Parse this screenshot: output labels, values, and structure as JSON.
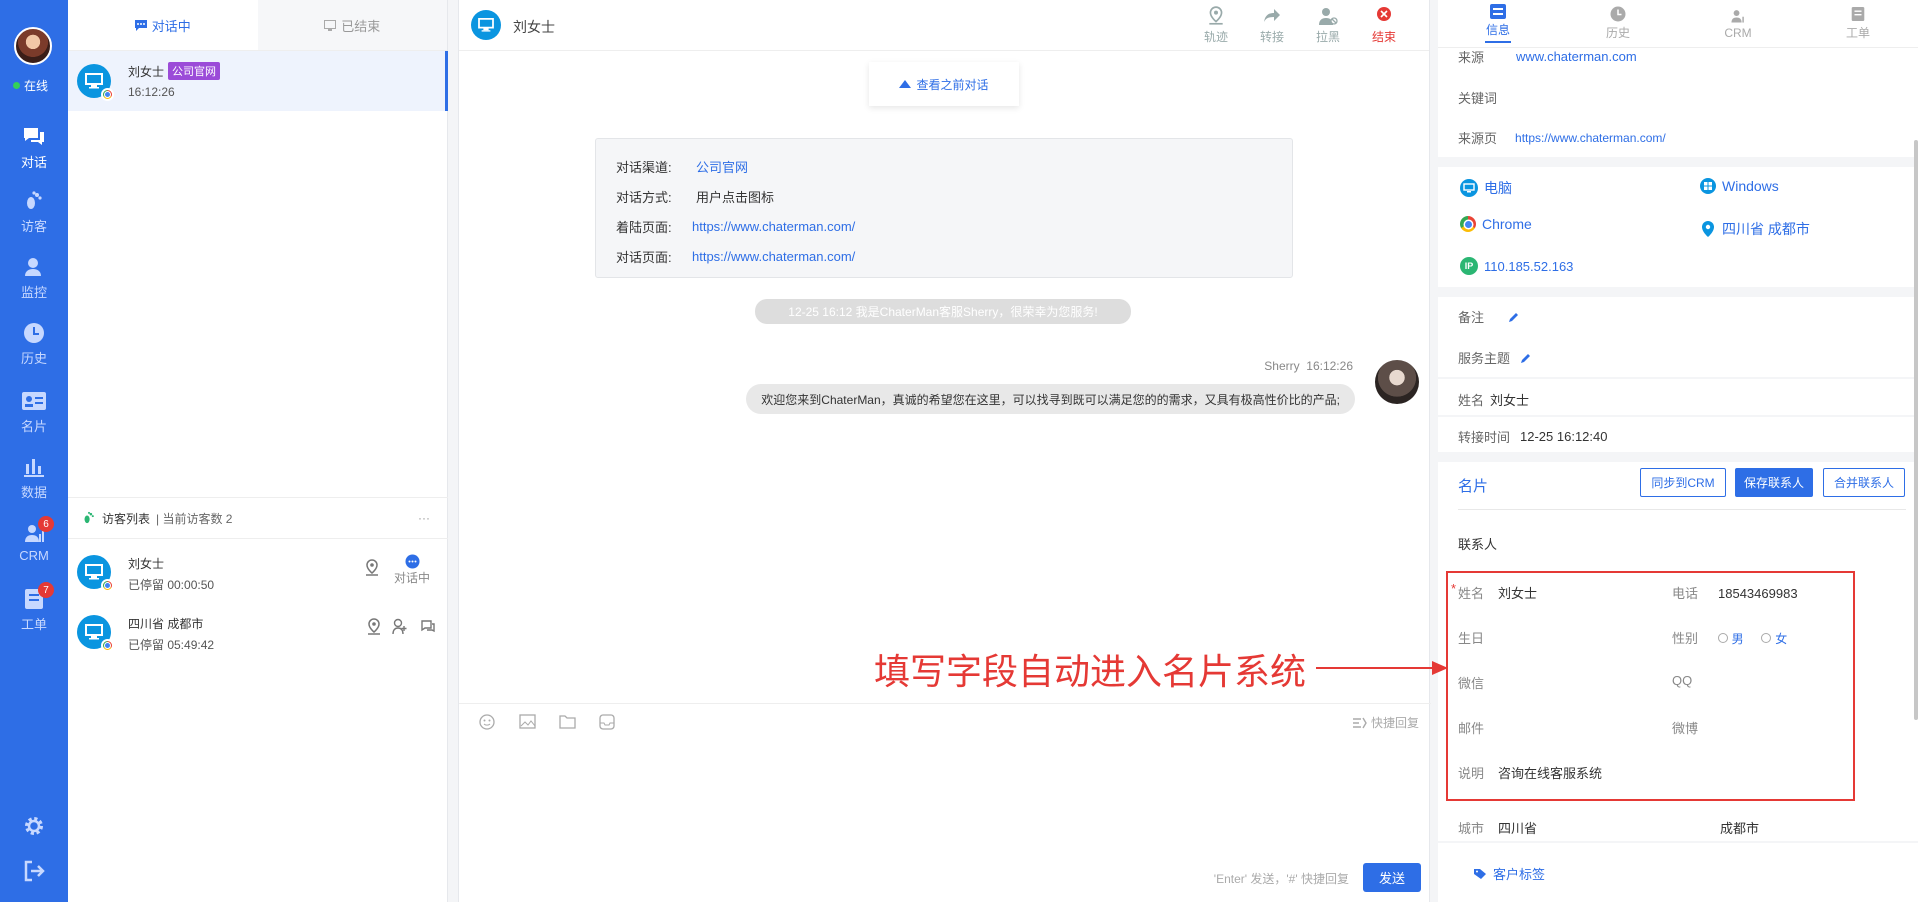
{
  "nav": {
    "status": "在线",
    "items": [
      {
        "label": "对话",
        "icon": "chat-icon"
      },
      {
        "label": "访客",
        "icon": "footprint-icon"
      },
      {
        "label": "监控",
        "icon": "monitor-user-icon"
      },
      {
        "label": "历史",
        "icon": "clock-icon"
      },
      {
        "label": "名片",
        "icon": "card-icon"
      },
      {
        "label": "数据",
        "icon": "bar-chart-icon"
      },
      {
        "label": "CRM",
        "icon": "crm-icon",
        "badge": "6"
      },
      {
        "label": "工单",
        "icon": "ticket-icon",
        "badge": "7"
      }
    ]
  },
  "convlist": {
    "tabs": [
      "对话中",
      "已结束"
    ],
    "active": {
      "name": "刘女士",
      "tag": "公司官网",
      "time": "16:12:26"
    },
    "visitors_title": "访客列表",
    "visitors_count": "| 当前访客数 2",
    "more": "···",
    "visitors": [
      {
        "name": "刘女士",
        "stay": "已停留 00:00:50",
        "status": "对话中"
      },
      {
        "name": "四川省 成都市",
        "stay": "已停留 05:49:42"
      }
    ]
  },
  "chat": {
    "title": "刘女士",
    "actions": [
      "轨迹",
      "转接",
      "拉黑",
      "结束"
    ],
    "history": "查看之前对话",
    "info": [
      {
        "k": "对话渠道:",
        "v": "公司官网"
      },
      {
        "k": "对话方式:",
        "v": "用户点击图标"
      },
      {
        "k": "着陆页面:",
        "v": "https://www.chaterman.com/"
      },
      {
        "k": "对话页面:",
        "v": "https://www.chaterman.com/"
      }
    ],
    "system_msg": "12-25 16:12 我是ChaterMan客服Sherry，很荣幸为您服务!",
    "agent": "Sherry",
    "agent_time": "16:12:26",
    "message": "欢迎您来到ChaterMan，真诚的希望您在这里，可以找寻到既可以满足您的的需求，又具有极高性价比的产品;",
    "quick_reply": "快捷回复",
    "hint": "'Enter' 发送，'#' 快捷回复",
    "send": "发送"
  },
  "right": {
    "tabs": [
      "信息",
      "历史",
      "CRM",
      "工单"
    ],
    "source_label": "来源",
    "source": "www.chaterman.com",
    "keyword_label": "关键词",
    "page_label": "来源页",
    "page": "https://www.chaterman.com/",
    "device": "电脑",
    "os": "Windows",
    "browser": "Chrome",
    "location": "四川省 成都市",
    "ip": "110.185.52.163",
    "note_label": "备注",
    "topic_label": "服务主题",
    "name_label": "姓名",
    "name": "刘女士",
    "transfer_label": "转接时间",
    "transfer": "12-25 16:12:40",
    "card_title": "名片",
    "btn_sync": "同步到CRM",
    "btn_save": "保存联系人",
    "btn_merge": "合并联系人",
    "contact": "联系人",
    "fields": {
      "name_label": "姓名",
      "name": "刘女士",
      "phone_label": "电话",
      "phone": "18543469983",
      "birthday_label": "生日",
      "gender_label": "性别",
      "male": "男",
      "female": "女",
      "wechat_label": "微信",
      "qq_label": "QQ",
      "email_label": "邮件",
      "weibo_label": "微博",
      "desc_label": "说明",
      "desc": "咨询在线客服系统"
    },
    "city_label": "城市",
    "province": "四川省",
    "city": "成都市",
    "tags": "客户标签"
  },
  "annotation": "填写字段自动进入名片系统",
  "colors": {
    "primary": "#2e6ee6",
    "danger": "#e53935",
    "tag": "#9b4bd8"
  }
}
